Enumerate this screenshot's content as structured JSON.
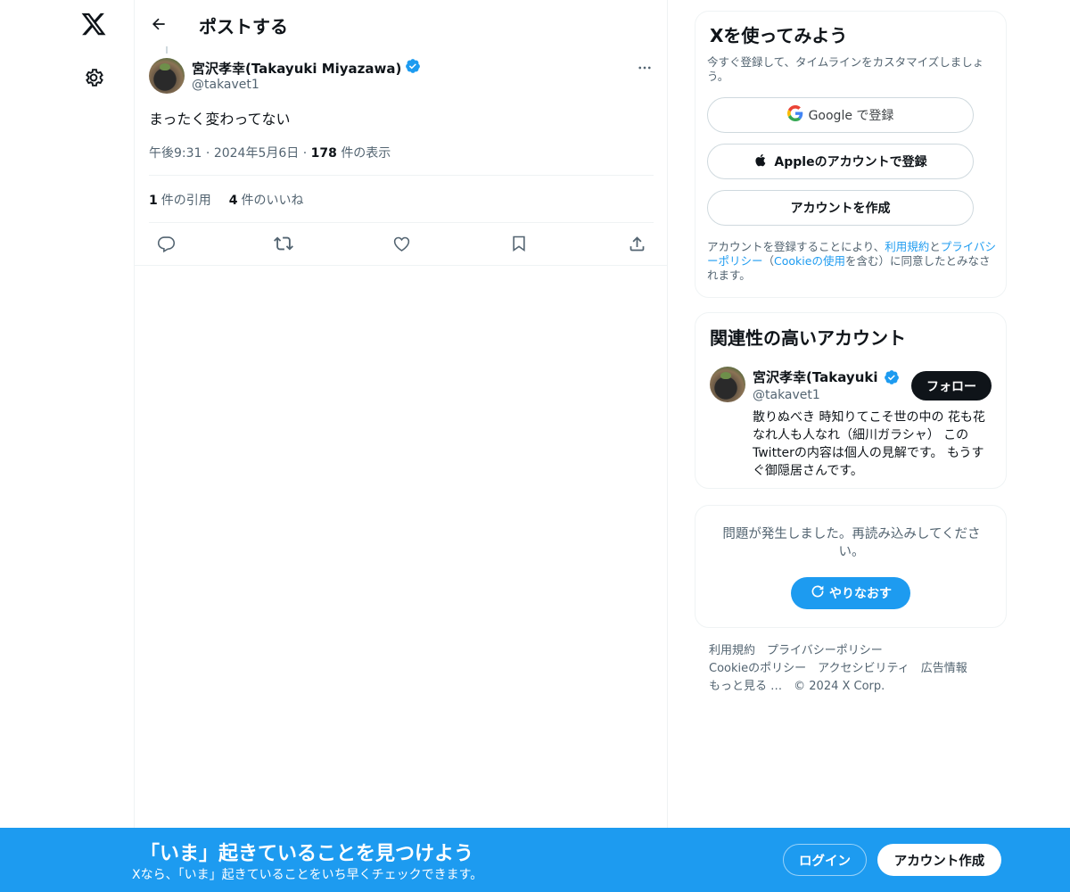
{
  "nav": {
    "logo_icon": "x-logo-icon",
    "settings_icon": "gear-icon"
  },
  "header": {
    "title": "ポストする",
    "back_icon": "arrow-left-icon"
  },
  "post": {
    "author_name": "宮沢孝幸(Takayuki Miyazawa)",
    "author_handle": "@takavet1",
    "text": "まったく変わってない",
    "time": "午後9:31",
    "date": "2024年5月6日",
    "views_count": "178",
    "views_label": "件の表示",
    "separator": "·",
    "quotes_count": "1",
    "quotes_label": "件の引用",
    "likes_count": "4",
    "likes_label": "件のいいね",
    "action_icons": [
      "reply-icon",
      "repost-icon",
      "like-icon",
      "bookmark-icon",
      "share-icon"
    ]
  },
  "signup_card": {
    "title": "Xを使ってみよう",
    "subtitle": "今すぐ登録して、タイムラインをカスタマイズしましょう。",
    "google_label": "Google で登録",
    "apple_label": "Appleのアカウントで登録",
    "create_label": "アカウントを作成",
    "legal_pre": "アカウントを登録することにより、",
    "legal_terms": "利用規約",
    "legal_and": "と",
    "legal_privacy": "プライバシーポリシー",
    "legal_mid": "（",
    "legal_cookie": "Cookieの使用",
    "legal_post": "を含む）に同意したとみなされます。"
  },
  "related_card": {
    "title": "関連性の高いアカウント",
    "name": "宮沢孝幸(Takayuki Miyazawa)",
    "handle": "@takavet1",
    "follow_label": "フォロー",
    "bio": "散りぬべき 時知りてこそ世の中の 花も花なれ人も人なれ（細川ガラシャ） このTwitterの内容は個人の見解です。 もうすぐ御隠居さんです。"
  },
  "error_card": {
    "message": "問題が発生しました。再読み込みしてください。",
    "retry_label": "やりなおす"
  },
  "footer": {
    "terms": "利用規約",
    "privacy": "プライバシーポリシー",
    "cookie": "Cookieのポリシー",
    "accessibility": "アクセシビリティ",
    "ads": "広告情報",
    "more": "もっと見る …",
    "copyright": "© 2024 X Corp."
  },
  "bottom_bar": {
    "title": "「いま」起きていることを見つけよう",
    "subtitle": "Xなら、「いま」起きていることをいち早くチェックできます。",
    "login_label": "ログイン",
    "signup_label": "アカウント作成"
  },
  "colors": {
    "accent": "#1d9bf0",
    "text_primary": "#0f1419",
    "text_secondary": "#536471",
    "border": "#eff3f4",
    "verified": "#1d9bf0"
  }
}
